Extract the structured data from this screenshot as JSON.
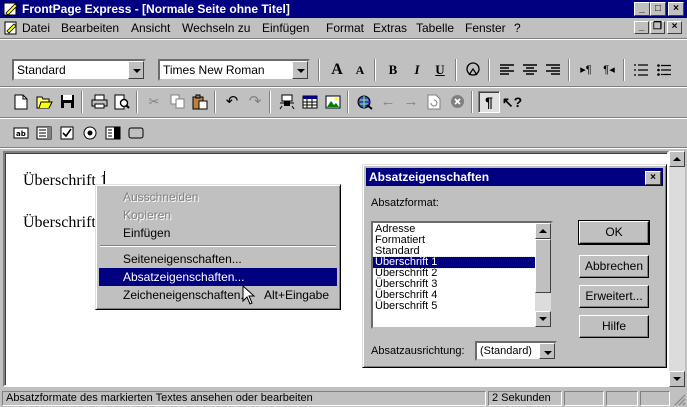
{
  "window": {
    "title": "FrontPage Express - [Normale Seite ohne Titel]",
    "minimize": "_",
    "maximize": "□",
    "close": "×"
  },
  "menu": {
    "items": [
      "Datei",
      "Bearbeiten",
      "Ansicht",
      "Wechseln zu",
      "Einfügen",
      "Format",
      "Extras",
      "Tabelle",
      "Fenster",
      "?"
    ],
    "mdi_minimize": "_",
    "mdi_restore": "❐",
    "mdi_close": "×"
  },
  "format_toolbar": {
    "style_value": "Standard",
    "font_value": "Times New Roman",
    "grow_font": "A",
    "shrink_font": "A",
    "bold": "B",
    "italic": "I",
    "underline": "U"
  },
  "editor": {
    "line1": "Überschrift 1",
    "line2": "Überschrift"
  },
  "context_menu": {
    "items": [
      {
        "label": "Ausschneiden",
        "enabled": false
      },
      {
        "label": "Kopieren",
        "enabled": false
      },
      {
        "label": "Einfügen",
        "enabled": true
      },
      {
        "label": "Seiteneigenschaften...",
        "enabled": true
      },
      {
        "label": "Absatzeigenschaften...",
        "enabled": true,
        "selected": true
      },
      {
        "label": "Zeicheneigenschaften...",
        "shortcut": "Alt+Eingabe",
        "enabled": true
      }
    ]
  },
  "dialog": {
    "title": "Absatzeigenschaften",
    "close": "×",
    "format_label": "Absatzformat:",
    "format_options": [
      "Adresse",
      "Formatiert",
      "Standard",
      "Überschrift 1",
      "Überschrift 2",
      "Überschrift 3",
      "Überschrift 4",
      "Überschrift 5"
    ],
    "selected_format": "Überschrift 1",
    "align_label": "Absatzausrichtung:",
    "align_value": "(Standard)",
    "ok": "OK",
    "cancel": "Abbrechen",
    "advanced": "Erweitert...",
    "help": "Hilfe"
  },
  "status": {
    "message": "Absatzformate des markierten Textes ansehen oder bearbeiten",
    "load_time": "2 Sekunden"
  },
  "colors": {
    "titlebar": "#000080",
    "face": "#c0c0c0",
    "selection": "#000080"
  }
}
